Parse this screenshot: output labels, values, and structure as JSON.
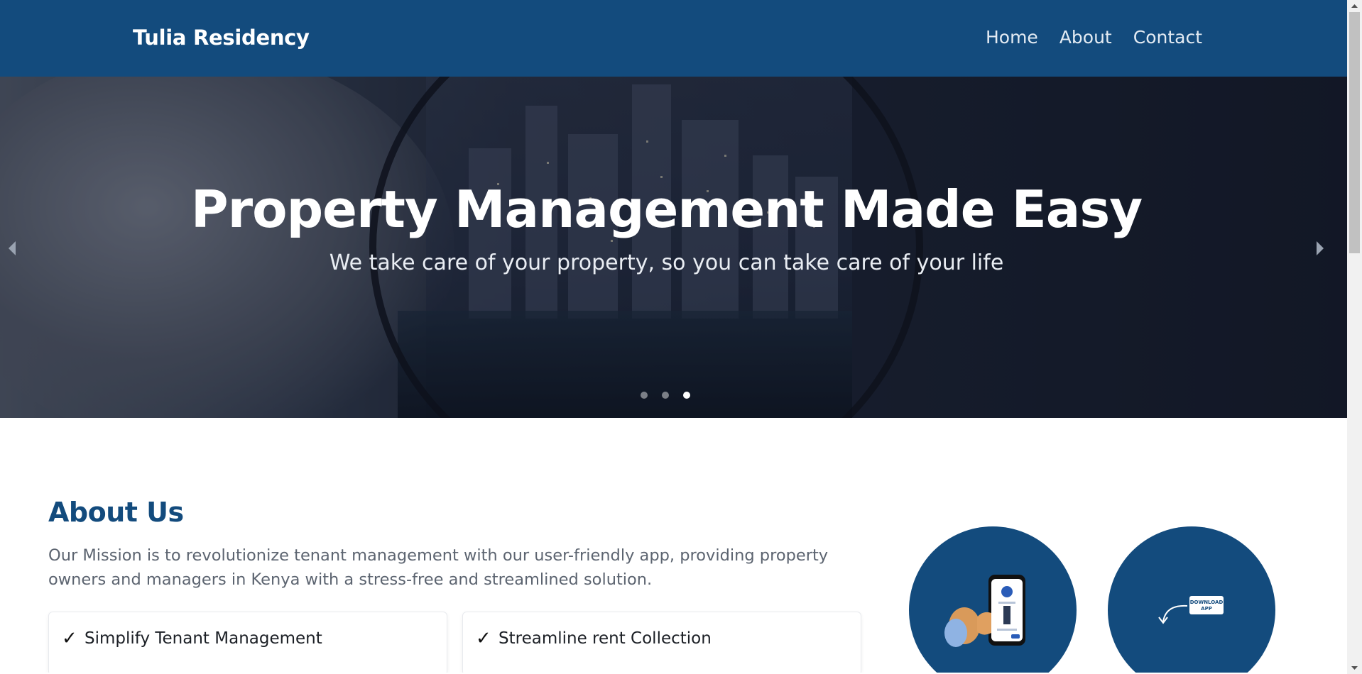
{
  "navbar": {
    "brand": "Tulia Residency",
    "links": [
      {
        "label": "Home"
      },
      {
        "label": "About"
      },
      {
        "label": "Contact"
      }
    ]
  },
  "hero": {
    "title": "Property Management Made Easy",
    "subtitle": "We take care of your property, so you can take care of your life",
    "slide_count": 3,
    "active_slide": 3
  },
  "about": {
    "title": "About Us",
    "text": "Our Mission is to revolutionize tenant management with our user-friendly app, providing property owners and managers in Kenya with a stress-free and streamlined solution.",
    "features": [
      {
        "check": "✓",
        "label": "Simplify Tenant Management"
      },
      {
        "check": "✓",
        "label": "Streamline rent Collection"
      }
    ],
    "illustrations": [
      {
        "name": "phone-in-hand-illustration"
      },
      {
        "name": "download-app-illustration",
        "text": "DOWNLOAD APP"
      }
    ]
  },
  "colors": {
    "primary": "#134b7d",
    "hero_overlay": "#1d2436",
    "text_muted": "#5c6470"
  }
}
